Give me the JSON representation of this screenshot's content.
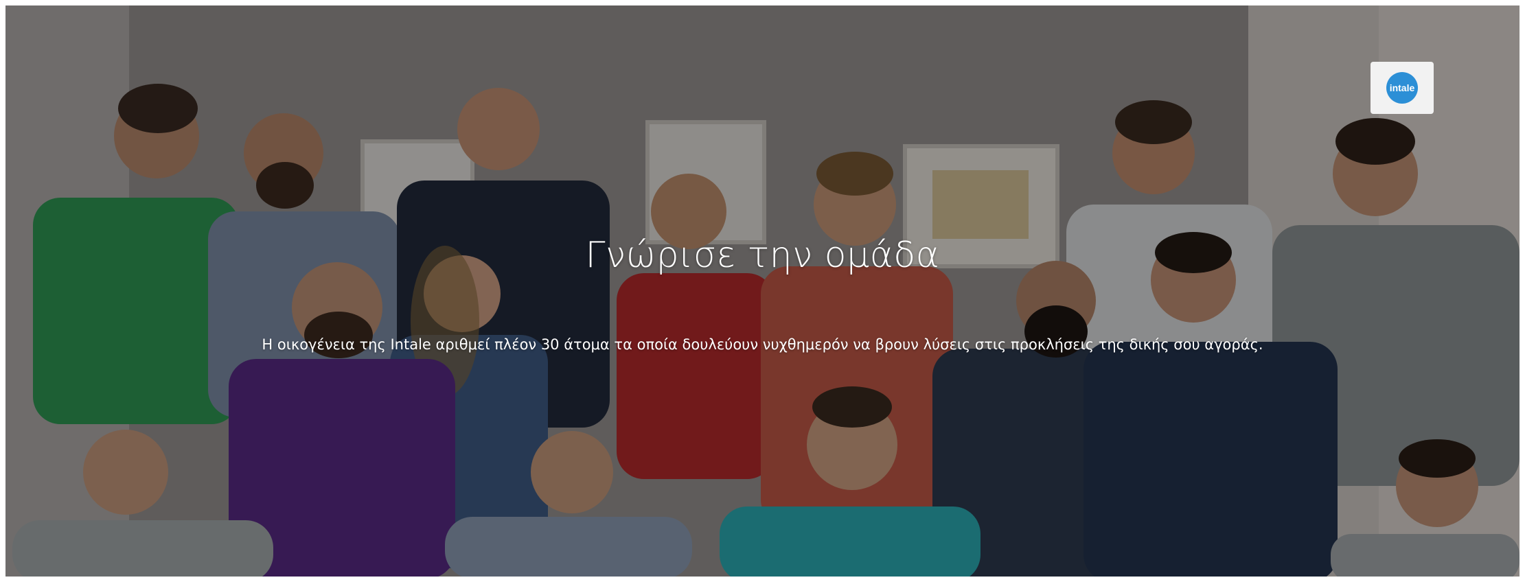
{
  "hero": {
    "title": "Γνώρισε την ομάδα",
    "subtitle": "Η οικογένεια της Intale αριθμεί πλέον 30 άτομα τα οποία δουλεύουν νυχθημερόν να βρουν λύσεις στις προκλήσεις της δικής σου αγοράς."
  },
  "logo": {
    "label": "intale",
    "color": "#2c8fd6"
  }
}
